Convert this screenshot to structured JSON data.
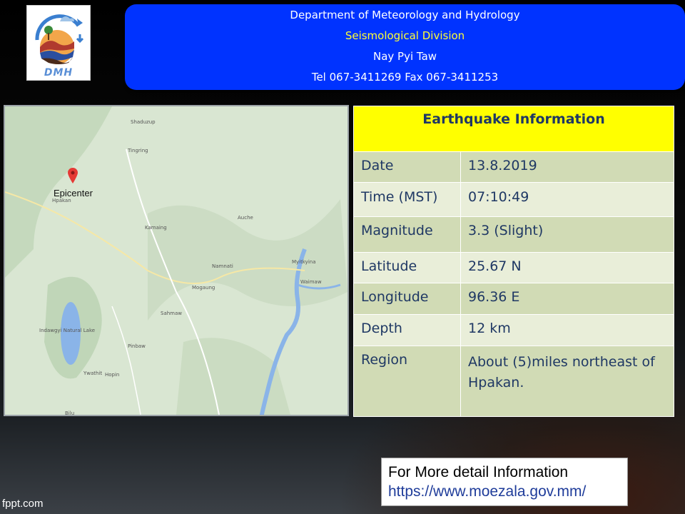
{
  "logo": {
    "text": "DMH"
  },
  "header": {
    "line1": "Department of Meteorology and Hydrology",
    "line2": "Seismological Division",
    "line3": "Nay Pyi Taw",
    "line4": "Tel 067-3411269 Fax 067-3411253"
  },
  "map": {
    "epicenter_label": "Epicenter",
    "places": [
      "Shaduzup",
      "Tingring",
      "Hpakan",
      "Auche",
      "Kamaing",
      "Namnati",
      "Myitkyina",
      "Waimaw",
      "Mogaung",
      "Sahmaw",
      "Indawgyi Natural Lake",
      "Pinbaw",
      "Hopin",
      "Ywathit",
      "Bilu"
    ]
  },
  "info": {
    "title": "Earthquake Information",
    "rows": [
      {
        "key": "Date",
        "value": "13.8.2019"
      },
      {
        "key": "Time (MST)",
        "value": "07:10:49"
      },
      {
        "key": "Magnitude",
        "value": "3.3 (Slight)"
      },
      {
        "key": "Latitude",
        "value": "25.67 N"
      },
      {
        "key": "Longitude",
        "value": "96.36 E"
      },
      {
        "key": "Depth",
        "value": "12 km"
      },
      {
        "key": "Region",
        "value": "About (5)miles northeast of Hpakan."
      }
    ]
  },
  "detail": {
    "line1": "For More detail Information",
    "line2": "https://www.moezala.gov.mm/"
  },
  "footer": {
    "brand": "fppt.com"
  },
  "colors": {
    "header_bg": "#0033ff",
    "title_yellow": "#ffff00",
    "row_dark": "#d1dbb5",
    "row_light": "#e9eed9",
    "table_text": "#1f3864"
  }
}
